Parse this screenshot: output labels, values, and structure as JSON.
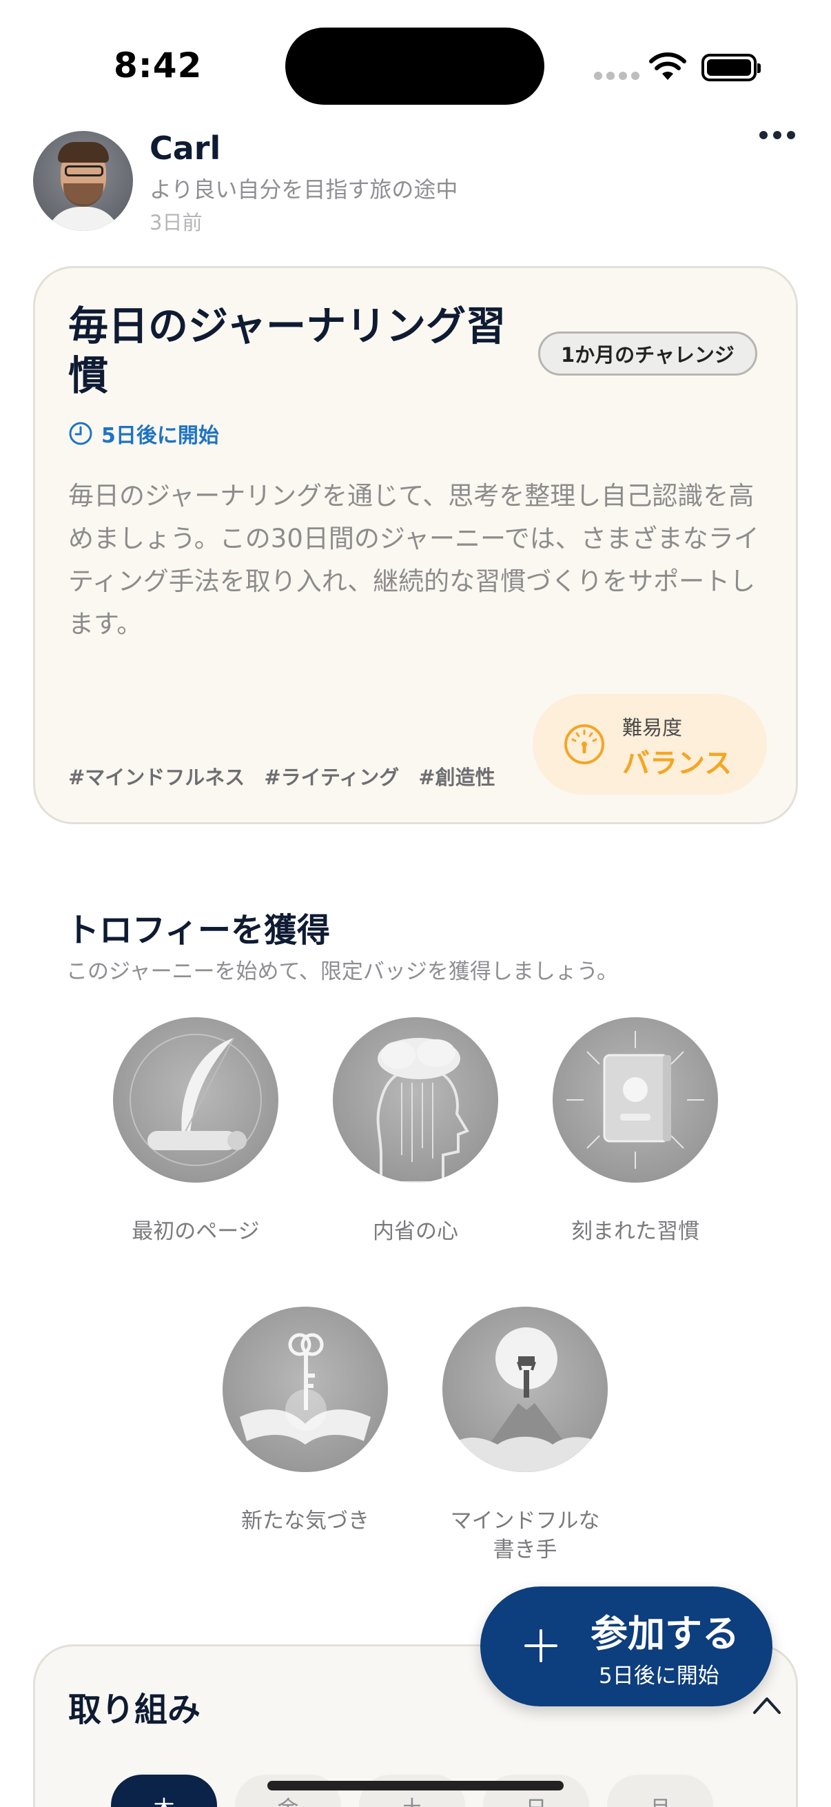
{
  "status_bar": {
    "time": "8:42"
  },
  "header": {
    "user_name": "Carl",
    "tagline": "より良い自分を目指す旅の途中",
    "time_ago": "3日前"
  },
  "card": {
    "title": "毎日のジャーナリング習慣",
    "chip": "1か月のチャレンジ",
    "start": "5日後に開始",
    "description": "毎日のジャーナリングを通じて、思考を整理し自己認識を高めましょう。この30日間のジャーニーでは、さまざまなライティング手法を取り入れ、継続的な習慣づくりをサポートします。",
    "tags": [
      "#マインドフルネス",
      "#ライティング",
      "#創造性"
    ],
    "difficulty_label": "難易度",
    "difficulty_value": "バランス",
    "accent_color": "#f5a524"
  },
  "trophies": {
    "title": "トロフィーを獲得",
    "subtitle": "このジャーニーを始めて、限定バッジを獲得しましょう。",
    "items": [
      {
        "label": "最初のページ",
        "icon": "feather-quill-icon"
      },
      {
        "label": "内省の心",
        "icon": "mind-head-icon"
      },
      {
        "label": "刻まれた習慣",
        "icon": "journal-book-icon"
      },
      {
        "label": "新たな気づき",
        "icon": "open-book-key-icon"
      },
      {
        "label": "マインドフルな書き手",
        "icon": "summit-figure-icon"
      }
    ]
  },
  "actions": {
    "title": "取り組み",
    "days": [
      "木",
      "金",
      "土",
      "日",
      "月"
    ]
  },
  "join": {
    "label": "参加する",
    "sub": "5日後に開始",
    "color": "#0d3e7e"
  }
}
